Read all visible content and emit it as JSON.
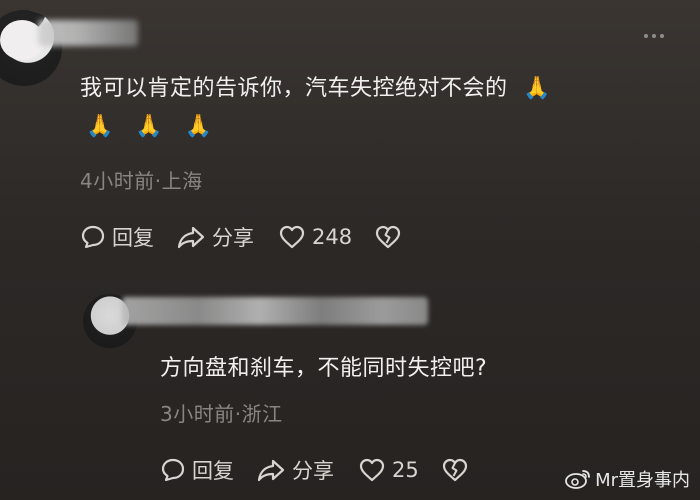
{
  "comment1": {
    "text": "我可以肯定的告诉你，汽车失控绝对不会的",
    "emoji_inline": "🙏",
    "emoji_row": [
      "🙏",
      "🙏",
      "🙏"
    ],
    "meta": "4小时前·上海",
    "actions": {
      "reply_label": "回复",
      "share_label": "分享",
      "like_count": "248"
    }
  },
  "comment2": {
    "text": "方向盘和刹车，不能同时失控吧?",
    "meta": "3小时前·浙江",
    "actions": {
      "reply_label": "回复",
      "share_label": "分享",
      "like_count": "25"
    }
  },
  "watermark": {
    "text": "Mr置身事内"
  },
  "colors": {
    "background": "#2c2927",
    "text": "#f2f0ee",
    "meta": "#8a8581",
    "action": "#d8d4cf"
  }
}
